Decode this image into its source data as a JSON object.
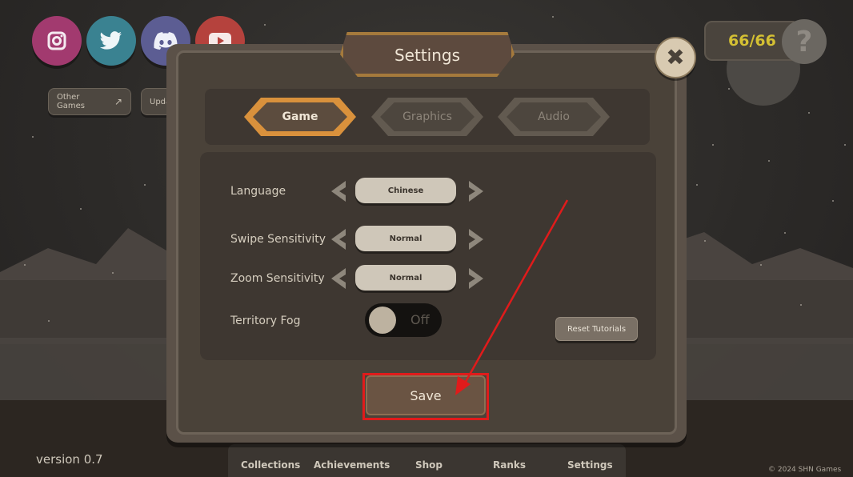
{
  "social": {
    "instagram": "instagram-icon",
    "twitter": "twitter-icon",
    "discord": "discord-icon",
    "youtube": "youtube-icon",
    "colors": [
      "#a23a6f",
      "#3a8291",
      "#5c5d93",
      "#b5423d"
    ]
  },
  "top_buttons": {
    "other_games": "Other Games",
    "updates": "Upda"
  },
  "counter": {
    "value": "66/66"
  },
  "help": {
    "label": "?"
  },
  "dialog": {
    "title": "Settings",
    "close_label": "✖",
    "tabs": [
      {
        "label": "Game",
        "active": true
      },
      {
        "label": "Graphics",
        "active": false
      },
      {
        "label": "Audio",
        "active": false
      }
    ],
    "settings": [
      {
        "label": "Language",
        "value": "Chinese"
      },
      {
        "label": "Swipe Sensitivity",
        "value": "Normal"
      },
      {
        "label": "Zoom Sensitivity",
        "value": "Normal"
      }
    ],
    "fog": {
      "label": "Territory Fog",
      "state": "Off"
    },
    "reset_label": "Reset Tutorials",
    "save_label": "Save"
  },
  "footer": {
    "version": "version 0.7",
    "copyright": "© 2024 SHN Games",
    "nav": [
      "Collections",
      "Achievements",
      "Shop",
      "Ranks",
      "Settings"
    ]
  },
  "colors": {
    "accent": "#d9913c",
    "highlight": "#e01b1b",
    "counter_text": "#d4c033"
  }
}
